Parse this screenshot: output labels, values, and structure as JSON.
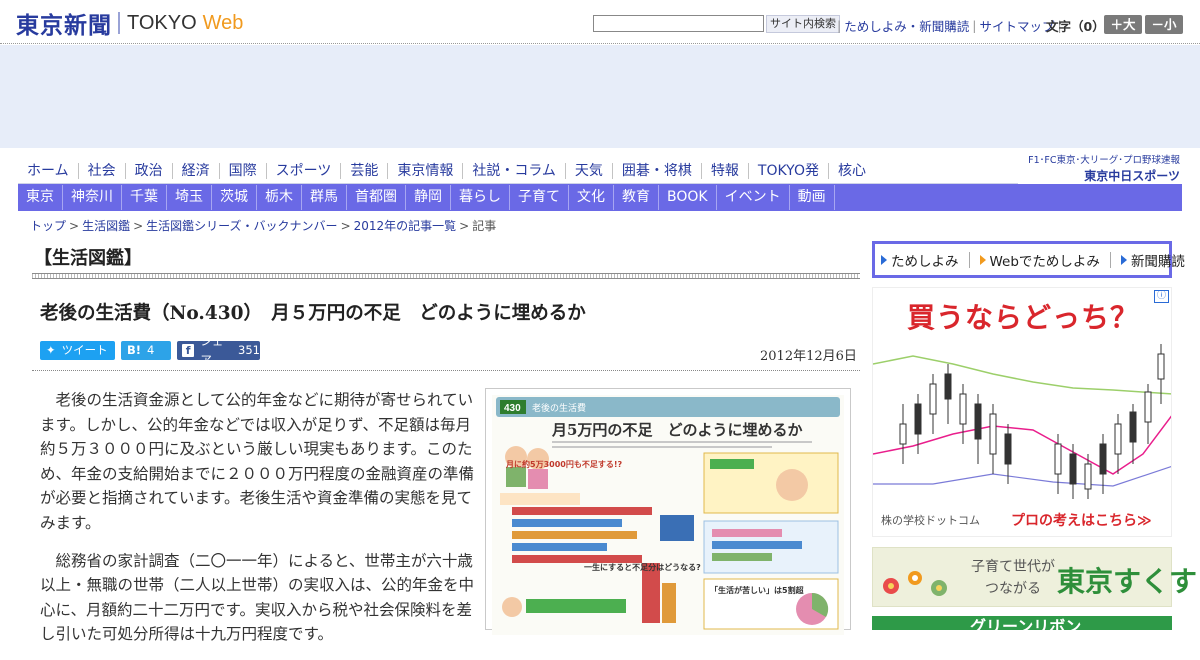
{
  "header": {
    "logo_jp": "東京新聞",
    "logo_en": "TOKYO",
    "logo_web": "Web",
    "search_placeholder": "",
    "search_button": "サイト内検索",
    "links": [
      "ためしよみ・新聞購読",
      "サイトマップ"
    ],
    "font_label": "文字（0）",
    "font_plus": "＋大",
    "font_minus": "－小"
  },
  "main_nav": [
    "ホーム",
    "社会",
    "政治",
    "経済",
    "国際",
    "スポーツ",
    "芸能",
    "東京情報",
    "社説・コラム",
    "天気",
    "囲碁・将棋",
    "特報",
    "TOKYO発",
    "核心"
  ],
  "chunichi": {
    "line1": "F1･FC東京･大リーグ･プロ野球速報",
    "line2": "東京中日スポーツ"
  },
  "regional_nav": [
    "東京",
    "神奈川",
    "千葉",
    "埼玉",
    "茨城",
    "栃木",
    "群馬",
    "首都圏",
    "静岡",
    "暮らし",
    "子育て",
    "文化",
    "教育",
    "BOOK",
    "イベント",
    "動画"
  ],
  "breadcrumb": [
    "トップ",
    "生活図鑑",
    "生活図鑑シリーズ・バックナンバー",
    "2012年の記事一覧",
    "記事"
  ],
  "section_title": "【生活図鑑】",
  "article": {
    "title": "老後の生活費（No.430）　月５万円の不足　どのように埋めるか",
    "date": "2012年12月6日",
    "tweet_label": "ツイート",
    "hatena_label": "B!",
    "hatena_count": "4",
    "share_label": "シェア",
    "share_count": "351",
    "paragraphs": [
      "老後の生活資金源として公的年金などに期待が寄せられています。しかし、公的年金などでは収入が足りず、不足額は毎月約５万３０００円に及ぶという厳しい現実もあります。このため、年金の支給開始までに２０００万円程度の金融資産の準備が必要と指摘されています。老後生活や資金準備の実態を見てみます。",
      "総務省の家計調査（二〇一一年）によると、世帯主が六十歳以上・無職の世帯（二人以上世帯）の実収入は、公的年金を中心に、月額約二十二万円です。実収入から税や社会保険料を差し引いた可処分所得は十九万円程度です。"
    ],
    "figure": {
      "number": "430",
      "series": "老後の生活費",
      "headline": "月5万円の不足　どのように埋めるか",
      "callout1": "月に約5万3000円も不足する!?",
      "callout2": "一生にすると不足分はどうなる?",
      "callout3": "「生活が苦しい」は5割超"
    }
  },
  "sidebar": {
    "tabs": [
      "ためしよみ",
      "Webでためしよみ",
      "新聞購読"
    ],
    "ad1_headline": "買うならどっち？",
    "ad1_brand": "株の学校ドットコム",
    "ad1_cta": "プロの考えはこちら≫",
    "ad2_line1": "子育て世代が",
    "ad2_line2": "つながる",
    "ad2_brand": "東京すくすく",
    "ad3_text": "グリーンリボン"
  },
  "colors": {
    "brand_blue": "#283b9e",
    "nav_purple": "#6a69e6",
    "web_orange": "#f19a1e",
    "twitter": "#1da1f2",
    "hatena": "#2da3e8",
    "facebook": "#3b5998"
  }
}
